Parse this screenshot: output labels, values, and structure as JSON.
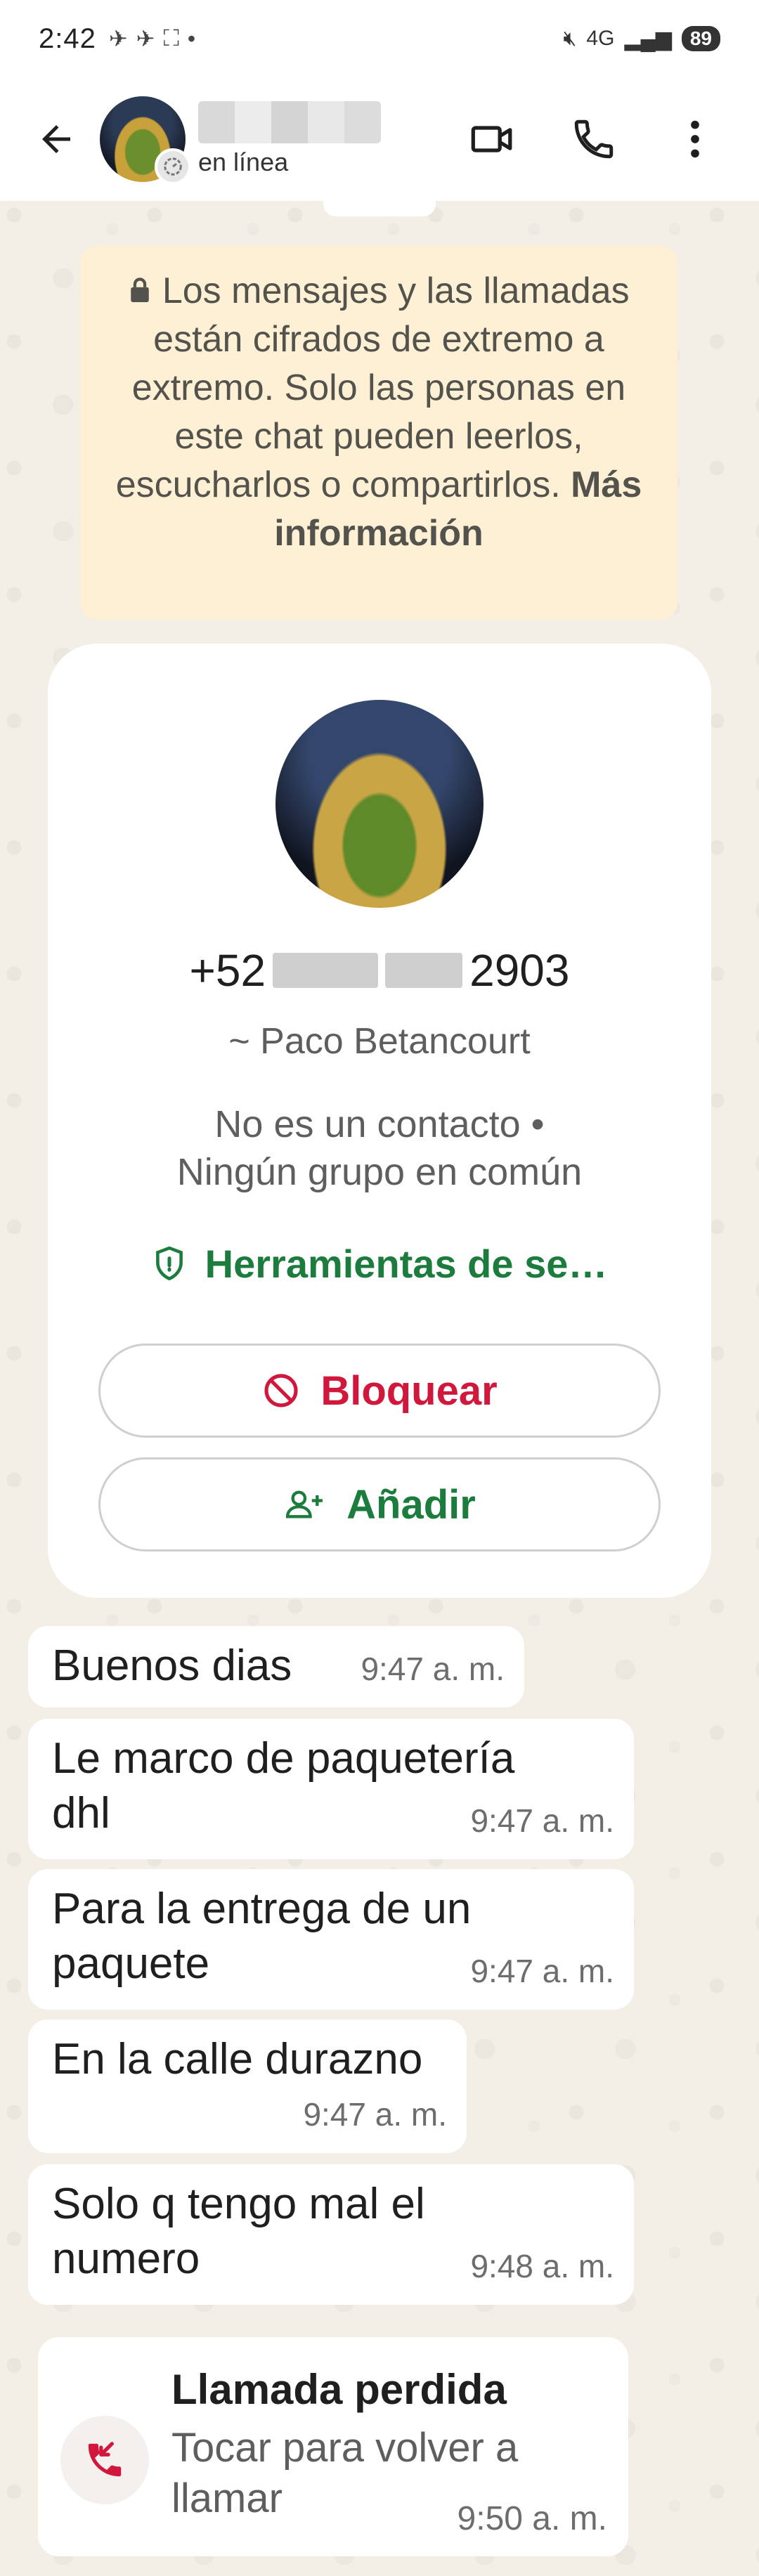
{
  "status_bar": {
    "time": "2:42",
    "network": "4G",
    "battery": "89"
  },
  "header": {
    "contact_status": "en línea"
  },
  "encryption_notice": {
    "text": "Los mensajes y las llamadas están cifrados de extremo a extremo. Solo las personas en este chat pueden leerlos, escucharlos o compartirlos.",
    "link": "Más información"
  },
  "profile": {
    "phone_prefix": "+52",
    "phone_suffix": "2903",
    "alias": "~ Paco Betancourt",
    "meta_line1": "No es un contacto •",
    "meta_line2": "Ningún grupo en común",
    "tools_label": "Herramientas de se…",
    "block_label": "Bloquear",
    "add_label": "Añadir"
  },
  "messages": [
    {
      "text": "Buenos dias",
      "time": "9:47 a. m."
    },
    {
      "text": "Le marco de paquetería dhl",
      "time": "9:47 a. m."
    },
    {
      "text": "Para la entrega de un paquete",
      "time": "9:47 a. m."
    },
    {
      "text": "En la calle durazno",
      "time": "9:47 a. m."
    },
    {
      "text": "Solo q tengo mal el numero",
      "time": "9:48 a. m."
    }
  ],
  "missed_call": {
    "title": "Llamada perdida",
    "subtitle": "Tocar para volver a llamar",
    "time": "9:50 a. m."
  },
  "colors": {
    "accent_green": "#1c7c3d",
    "danger_red": "#d1173c",
    "notice_bg": "#fdf0d4",
    "chat_bg": "#f3eee6"
  }
}
